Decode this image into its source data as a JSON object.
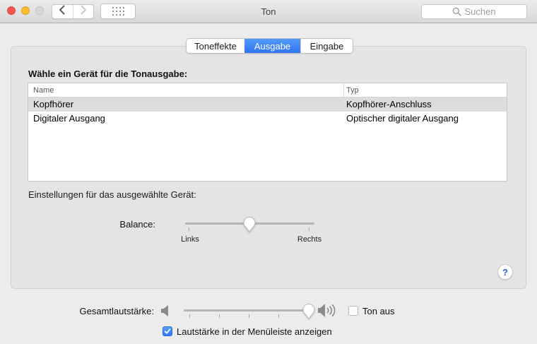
{
  "window": {
    "title": "Ton"
  },
  "titlebar": {
    "search_placeholder": "Suchen"
  },
  "tabs": [
    {
      "label": "Toneffekte",
      "selected": false
    },
    {
      "label": "Ausgabe",
      "selected": true
    },
    {
      "label": "Eingabe",
      "selected": false
    }
  ],
  "output_section": {
    "heading": "Wähle ein Gerät für die Tonausgabe:",
    "table": {
      "columns": [
        "Name",
        "Typ"
      ],
      "rows": [
        {
          "name": "Kopfhörer",
          "type": "Kopfhörer-Anschluss",
          "selected": true
        },
        {
          "name": "Digitaler Ausgang",
          "type": "Optischer digitaler Ausgang",
          "selected": false
        }
      ]
    }
  },
  "settings_section": {
    "heading": "Einstellungen für das ausgewählte Gerät:",
    "balance": {
      "label": "Balance:",
      "left_label": "Links",
      "right_label": "Rechts",
      "value_percent": 50
    }
  },
  "help_button": {
    "label": "?"
  },
  "volume": {
    "label": "Gesamtlautstärke:",
    "value_percent": 95,
    "mute_label": "Ton aus",
    "mute_checked": false,
    "menubar_label": "Lautstärke in der Menüleiste anzeigen",
    "menubar_checked": true
  },
  "colors": {
    "accent": "#3b7df5",
    "selected_row": "#dcdcdc",
    "window_background": "#ececec",
    "panel_background": "#e4e4e4"
  }
}
